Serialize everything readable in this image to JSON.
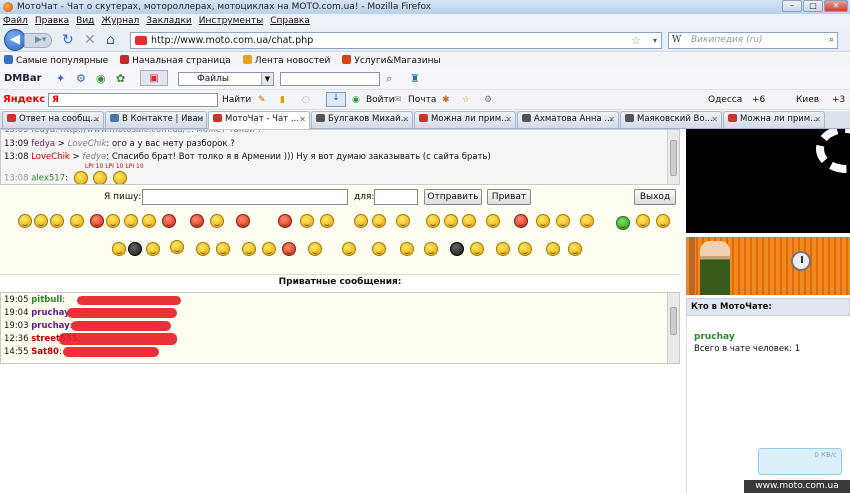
{
  "window": {
    "title": "МотоЧат - Чат о скутерах, мотороллерах, мотоциклах на MOTO.com.ua! - Mozilla Firefox"
  },
  "menu": [
    "Файл",
    "Правка",
    "Вид",
    "Журнал",
    "Закладки",
    "Инструменты",
    "Справка"
  ],
  "nav": {
    "url": "http://www.moto.com.ua/chat.php",
    "search_placeholder": "Википедия (ru)",
    "search_engine": "W"
  },
  "bookmarks": [
    {
      "label": "Самые популярные",
      "color": "#3c6fc4"
    },
    {
      "label": "Начальная страница",
      "color": "#c62828"
    },
    {
      "label": "Лента новостей",
      "color": "#e8a317"
    },
    {
      "label": "Услуги&Магазины",
      "color": "#d84315"
    }
  ],
  "dmbar": {
    "logo": "DMBar",
    "select_value": "Файлы"
  },
  "yandex": {
    "logo": "Яндекс",
    "query": "Я",
    "find": "Найти",
    "login": "Войти",
    "mail": "Почта",
    "weather1": "Одесса",
    "temp1": "+6",
    "weather2": "Киев",
    "temp2": "+3"
  },
  "tabs": [
    {
      "label": "Ответ на сообщ...",
      "icon_color": "#d32f2f",
      "active": false
    },
    {
      "label": "В Контакте | Иван ...",
      "icon_color": "#4a76a8",
      "active": false
    },
    {
      "label": "МотоЧат - Чат ...",
      "icon_color": "#d32f2f",
      "active": true
    },
    {
      "label": "Булгаков Михай...",
      "icon_color": "#555555",
      "active": false
    },
    {
      "label": "Можна ли прим...",
      "icon_color": "#d32f2f",
      "active": false
    },
    {
      "label": "Ахматова Анна ...",
      "icon_color": "#555555",
      "active": false
    },
    {
      "label": "Маяковский Во...",
      "icon_color": "#555555",
      "active": false
    },
    {
      "label": "Можна ли прим...",
      "icon_color": "#d32f2f",
      "active": false
    }
  ],
  "chat": {
    "lines": [
      {
        "time": "13:09",
        "nick": "fedya",
        "to": "LoveChik",
        "text": "ого а у вас нету разборок ?"
      },
      {
        "time": "13:08",
        "nick": "LoveChik",
        "to": "fedya",
        "text": "Спасибо брат! Вот толко я в Армении ))) Ну я вот думаю заказывать (с сайта брать)"
      }
    ],
    "partial_nick": "alex517",
    "smile_tag": "LPI 10",
    "i_write_label": "Я пишу:",
    "to_label": "для:",
    "send_button": "Отправить",
    "private_button": "Приват",
    "exit_button": "Выход"
  },
  "private": {
    "title": "Приватные сообщения:",
    "lines": [
      {
        "time": "19:05",
        "nick": "pitbull",
        "color": "#2a8a2a"
      },
      {
        "time": "19:04",
        "nick": "pruchay",
        "color": "#6a1a8a"
      },
      {
        "time": "19:03",
        "nick": "pruchay",
        "color": "#6a1a8a"
      },
      {
        "time": "12:36",
        "nick": "street555",
        "color": "#c00000"
      },
      {
        "time": "14:55",
        "nick": "Sat80",
        "color": "#c00000"
      }
    ]
  },
  "sidebar": {
    "who_title": "Кто в МотоЧате:",
    "user": "pruchay",
    "total": "Всего в чате человек: 1"
  },
  "widget": {
    "label": "0 КБ/с"
  },
  "footer": "www.moto.com.ua"
}
